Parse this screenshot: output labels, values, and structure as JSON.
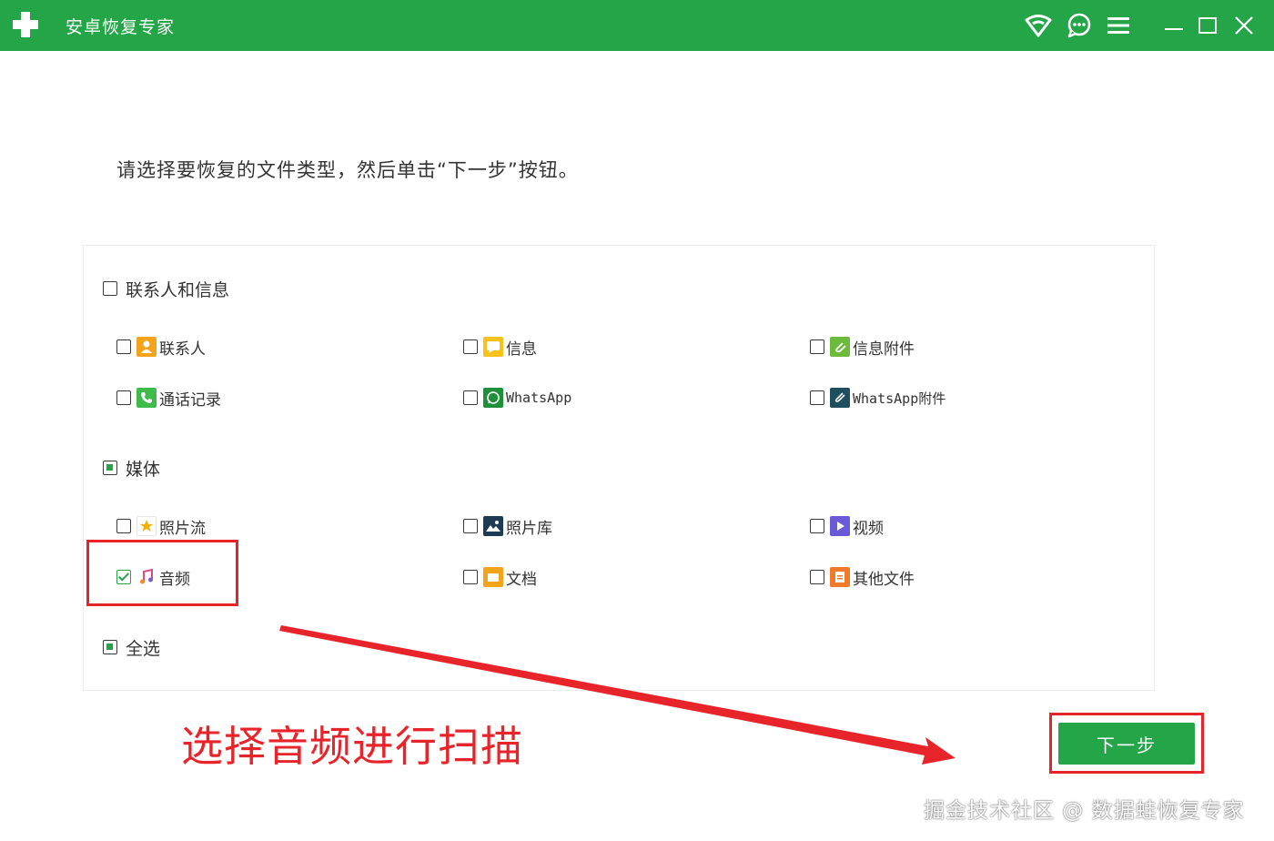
{
  "window": {
    "title": "安卓恢复专家",
    "controls": [
      "wifi-icon",
      "chat-icon",
      "menu-icon",
      "minimize-icon",
      "maximize-icon",
      "close-icon"
    ]
  },
  "instruction": "请选择要恢复的文件类型，然后单击“下一步”按钮。",
  "groups": {
    "contacts_messages": {
      "label": "联系人和信息",
      "state": "unchecked",
      "items": [
        {
          "label": "联系人",
          "icon": "contact-icon",
          "checked": false
        },
        {
          "label": "信息",
          "icon": "message-icon",
          "checked": false
        },
        {
          "label": "信息附件",
          "icon": "attachment-icon",
          "checked": false
        },
        {
          "label": "通话记录",
          "icon": "phone-icon",
          "checked": false
        },
        {
          "label": "WhatsApp",
          "icon": "whatsapp-icon",
          "checked": false
        },
        {
          "label": "WhatsApp附件",
          "icon": "whatsapp-attachment-icon",
          "checked": false
        }
      ]
    },
    "media": {
      "label": "媒体",
      "state": "partial",
      "items": [
        {
          "label": "照片流",
          "icon": "photostream-icon",
          "checked": false
        },
        {
          "label": "照片库",
          "icon": "photo-library-icon",
          "checked": false
        },
        {
          "label": "视频",
          "icon": "video-icon",
          "checked": false
        },
        {
          "label": "音频",
          "icon": "audio-icon",
          "checked": true
        },
        {
          "label": "文档",
          "icon": "document-icon",
          "checked": false
        },
        {
          "label": "其他文件",
          "icon": "other-files-icon",
          "checked": false
        }
      ]
    },
    "select_all": {
      "label": "全选",
      "state": "partial"
    }
  },
  "next_button": "下一步",
  "annotation": "选择音频进行扫描",
  "watermark": "掘金技术社区 @ 数据蛙恢复专家",
  "colors": {
    "brand": "#23a548",
    "annotation": "#e8242b"
  }
}
